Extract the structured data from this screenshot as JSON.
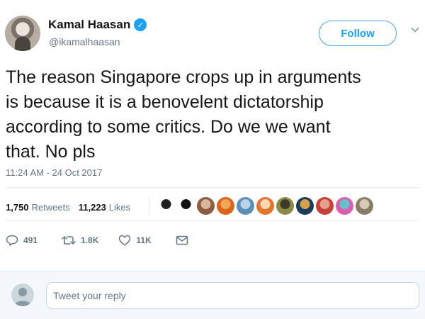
{
  "author": {
    "display_name": "Kamal Haasan",
    "handle": "@ikamalhaasan",
    "verified_glyph": "✓",
    "verified_color": "#1da1f2"
  },
  "follow_button": {
    "label": "Follow"
  },
  "tweet": {
    "lines": [
      "The reason  Singapore crops up in arguments",
      "is because it is a benovelent dictatorship",
      "according to some critics. Do we we want",
      "that. No pls"
    ],
    "timestamp": "11:24 AM - 24 Oct 2017"
  },
  "stats": {
    "retweets_count": "1,750",
    "retweets_label": "Retweets",
    "likes_count": "11,223",
    "likes_label": "Likes"
  },
  "liker_avatars": [
    {
      "colors": [
        "#ffffff",
        "#222222"
      ]
    },
    {
      "colors": [
        "#ffffff",
        "#111111"
      ]
    },
    {
      "colors": [
        "#8c5b43",
        "#d9b59a"
      ]
    },
    {
      "colors": [
        "#d9651f",
        "#f2a65a"
      ]
    },
    {
      "colors": [
        "#5b8fb8",
        "#b9d3e8"
      ]
    },
    {
      "colors": [
        "#e3752f",
        "#fbd7b5"
      ]
    },
    {
      "colors": [
        "#8c8a4b",
        "#3a3a25"
      ]
    },
    {
      "colors": [
        "#1b3d5a",
        "#d4a24c"
      ]
    },
    {
      "colors": [
        "#c2423a",
        "#e8a08d"
      ]
    },
    {
      "colors": [
        "#d960b0",
        "#66c2c9"
      ]
    },
    {
      "colors": [
        "#8a7b68",
        "#d8cbb6"
      ]
    }
  ],
  "actions": {
    "replies": "491",
    "retweets": "1.8K",
    "likes": "11K"
  },
  "reply_box": {
    "placeholder": "Tweet your reply"
  },
  "colors": {
    "accent": "#1da1f2",
    "muted_text": "#657786",
    "text": "#14171a",
    "divider": "#e6ecf0",
    "reply_bg": "#f5f8fa"
  }
}
